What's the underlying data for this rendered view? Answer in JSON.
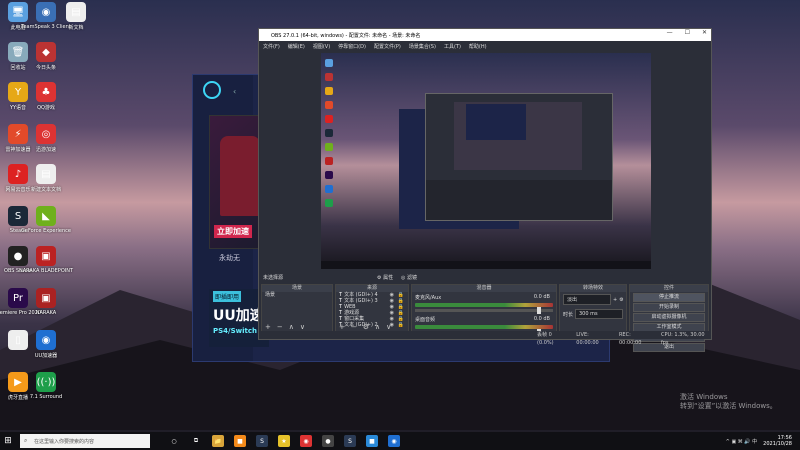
{
  "desktop": {
    "icons": [
      {
        "label": "此电脑",
        "glyph": "🖥",
        "color": "#5aa0e0"
      },
      {
        "label": "TeamSpeak 3 Client",
        "glyph": "◉",
        "color": "#3a6fb5"
      },
      {
        "label": "新文档",
        "glyph": "▤",
        "color": "#eeeeee"
      },
      {
        "label": "回收站",
        "glyph": "🗑",
        "color": "#8ab"
      },
      {
        "label": "今日头条",
        "glyph": "◆",
        "color": "#b33"
      },
      {
        "label": "",
        "glyph": "",
        "color": ""
      },
      {
        "label": "YY语音",
        "glyph": "Y",
        "color": "#e6a817"
      },
      {
        "label": "QQ游戏",
        "glyph": "♣",
        "color": "#d33"
      },
      {
        "label": "",
        "glyph": "",
        "color": ""
      },
      {
        "label": "雷神加速器",
        "glyph": "⚡",
        "color": "#e24a2a"
      },
      {
        "label": "迅游加速",
        "glyph": "◎",
        "color": "#d33"
      },
      {
        "label": "",
        "glyph": "",
        "color": ""
      },
      {
        "label": "网易云音乐",
        "glyph": "♪",
        "color": "#d22"
      },
      {
        "label": "新建文本文档",
        "glyph": "▤",
        "color": "#eee"
      },
      {
        "label": "",
        "glyph": "",
        "color": ""
      },
      {
        "label": "Steam",
        "glyph": "S",
        "color": "#1b2838"
      },
      {
        "label": "GeForce Experience",
        "glyph": "◣",
        "color": "#6fb01c"
      },
      {
        "label": "",
        "glyph": "",
        "color": ""
      },
      {
        "label": "OBS Studio",
        "glyph": "●",
        "color": "#222"
      },
      {
        "label": "NARAKA BLADEPOINT",
        "glyph": "▣",
        "color": "#b22"
      },
      {
        "label": "",
        "glyph": "",
        "color": ""
      },
      {
        "label": "Premiere Pro 2020",
        "glyph": "Pr",
        "color": "#2a0a4a"
      },
      {
        "label": "NARAKA",
        "glyph": "▣",
        "color": "#a22"
      },
      {
        "label": "",
        "glyph": "",
        "color": ""
      },
      {
        "label": "",
        "glyph": "▯",
        "color": "#eee"
      },
      {
        "label": "UU加速器",
        "glyph": "◉",
        "color": "#1f6fd1"
      },
      {
        "label": "",
        "glyph": "",
        "color": ""
      },
      {
        "label": "虎牙直播",
        "glyph": "▶",
        "color": "#f59a1a"
      },
      {
        "label": "7.1 Surround",
        "glyph": "((·))",
        "color": "#1e9e4a"
      }
    ]
  },
  "uu": {
    "banner_cta": "立即加速",
    "main_text": "永劫无",
    "promo_tag": "即插即用",
    "promo_big": "UU加速",
    "promo_sub": "PS4/Switch"
  },
  "obs": {
    "title": "OBS 27.0.1 (64-bit, windows) - 配置文件: 未命名 - 场景: 未命名",
    "menu": [
      "文件(F)",
      "编辑(E)",
      "视图(V)",
      "停靠窗口(D)",
      "配置文件(P)",
      "场景集合(S)",
      "工具(T)",
      "帮助(H)"
    ],
    "toolbar_label": "未选择源",
    "props_btn": "⚙ 属性",
    "filters_btn": "◎ 滤镜",
    "scenes": {
      "header": "场景",
      "items": [
        "场景"
      ]
    },
    "sources": {
      "header": "来源",
      "items": [
        "文本 (GDI+) 4",
        "文本 (GDI+) 3",
        "WEB",
        "游戏源",
        "窗口采集",
        "文本 (GDI+) 2"
      ]
    },
    "mixer": {
      "header": "混音器",
      "channels": [
        {
          "name": "麦克风/Aux",
          "db": "0.0 dB"
        },
        {
          "name": "桌面音频",
          "db": "0.0 dB"
        }
      ]
    },
    "transitions": {
      "header": "转场特效",
      "type": "淡出",
      "duration_label": "时长",
      "duration": "300 ms"
    },
    "controls": {
      "header": "控件",
      "buttons": [
        "停止推流",
        "开始录制",
        "启动虚拟摄像机",
        "工作室模式",
        "设置",
        "退出"
      ]
    },
    "status": {
      "drop": "丢帧 0 (0.0%)",
      "live": "LIVE: 00:00:00",
      "rec": "REC: 00:00:00",
      "cpu": "CPU: 1.3%, 30.00 fps"
    }
  },
  "taskbar": {
    "search_placeholder": "在这里输入你要搜索的内容",
    "apps": [
      {
        "glyph": "○",
        "color": "#101014"
      },
      {
        "glyph": "⧉",
        "color": "#101014"
      },
      {
        "glyph": "📁",
        "color": "#d9a53a"
      },
      {
        "glyph": "■",
        "color": "#f38a1a"
      },
      {
        "glyph": "S",
        "color": "#2b3b55"
      },
      {
        "glyph": "★",
        "color": "#e6c22a"
      },
      {
        "glyph": "◉",
        "color": "#d33"
      },
      {
        "glyph": "●",
        "color": "#444"
      },
      {
        "glyph": "S",
        "color": "#2b3b55"
      },
      {
        "glyph": "■",
        "color": "#2a8ad8"
      },
      {
        "glyph": "◉",
        "color": "#1f6fd1"
      }
    ],
    "tray": "^ ▣ ⌘ 🔊 中",
    "time": "17:56",
    "date": "2021/10/28"
  },
  "watermark": {
    "line1": "激活 Windows",
    "line2": "转到“设置”以激活 Windows。"
  }
}
